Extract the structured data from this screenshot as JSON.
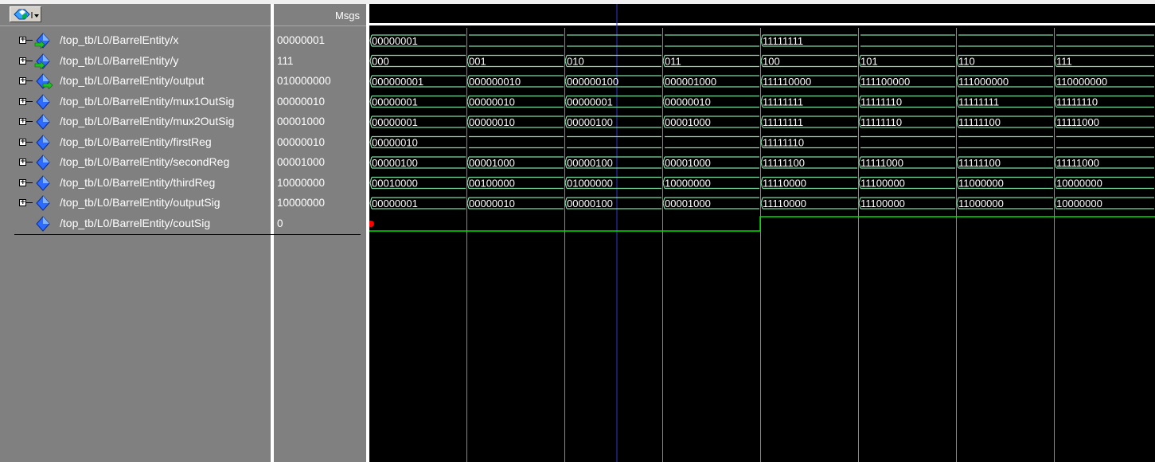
{
  "header": {
    "msgs_label": "Msgs"
  },
  "signals": [
    {
      "name": "/top_tb/L0/BarrelEntity/x",
      "value": "00000001",
      "expandable": true,
      "icon": "input-bus-icon"
    },
    {
      "name": "/top_tb/L0/BarrelEntity/y",
      "value": "111",
      "expandable": true,
      "icon": "input-bus-icon"
    },
    {
      "name": "/top_tb/L0/BarrelEntity/output",
      "value": "010000000",
      "expandable": true,
      "icon": "output-bus-icon"
    },
    {
      "name": "/top_tb/L0/BarrelEntity/mux1OutSig",
      "value": "00000010",
      "expandable": true,
      "icon": "signal-icon"
    },
    {
      "name": "/top_tb/L0/BarrelEntity/mux2OutSig",
      "value": "00001000",
      "expandable": true,
      "icon": "signal-icon"
    },
    {
      "name": "/top_tb/L0/BarrelEntity/firstReg",
      "value": "00000010",
      "expandable": true,
      "icon": "signal-icon"
    },
    {
      "name": "/top_tb/L0/BarrelEntity/secondReg",
      "value": "00001000",
      "expandable": true,
      "icon": "signal-icon"
    },
    {
      "name": "/top_tb/L0/BarrelEntity/thirdReg",
      "value": "10000000",
      "expandable": true,
      "icon": "signal-icon"
    },
    {
      "name": "/top_tb/L0/BarrelEntity/outputSig",
      "value": "10000000",
      "expandable": true,
      "icon": "signal-icon"
    },
    {
      "name": "/top_tb/L0/BarrelEntity/coutSig",
      "value": "0",
      "expandable": false,
      "icon": "signal-icon"
    }
  ],
  "waves": [
    [
      "00000001",
      "",
      "",
      "",
      "11111111",
      "",
      "",
      ""
    ],
    [
      "000",
      "001",
      "010",
      "011",
      "100",
      "101",
      "110",
      "111"
    ],
    [
      "000000001",
      "000000010",
      "000000100",
      "000001000",
      "111110000",
      "111100000",
      "111000000",
      "110000000"
    ],
    [
      "00000001",
      "00000010",
      "00000001",
      "00000010",
      "11111111",
      "11111110",
      "11111111",
      "11111110"
    ],
    [
      "00000001",
      "00000010",
      "00000100",
      "00001000",
      "11111111",
      "11111110",
      "11111100",
      "11111000"
    ],
    [
      "00000010",
      "",
      "",
      "",
      "11111110",
      "",
      "",
      ""
    ],
    [
      "00000100",
      "00001000",
      "00000100",
      "00001000",
      "11111100",
      "11111000",
      "11111100",
      "11111000"
    ],
    [
      "00010000",
      "00100000",
      "01000000",
      "10000000",
      "11110000",
      "11100000",
      "11000000",
      "10000000"
    ],
    [
      "00000001",
      "00000010",
      "00000100",
      "00001000",
      "11110000",
      "11100000",
      "11000000",
      "10000000"
    ]
  ],
  "cout_levels": [
    0,
    0,
    0,
    0,
    1,
    1,
    1,
    1
  ],
  "colors": {
    "wave_bus": "#7dd9a2",
    "wave_bit": "#00e000",
    "grid": "#888888",
    "cursor": "#3333cc",
    "marker": "#ff0000"
  }
}
